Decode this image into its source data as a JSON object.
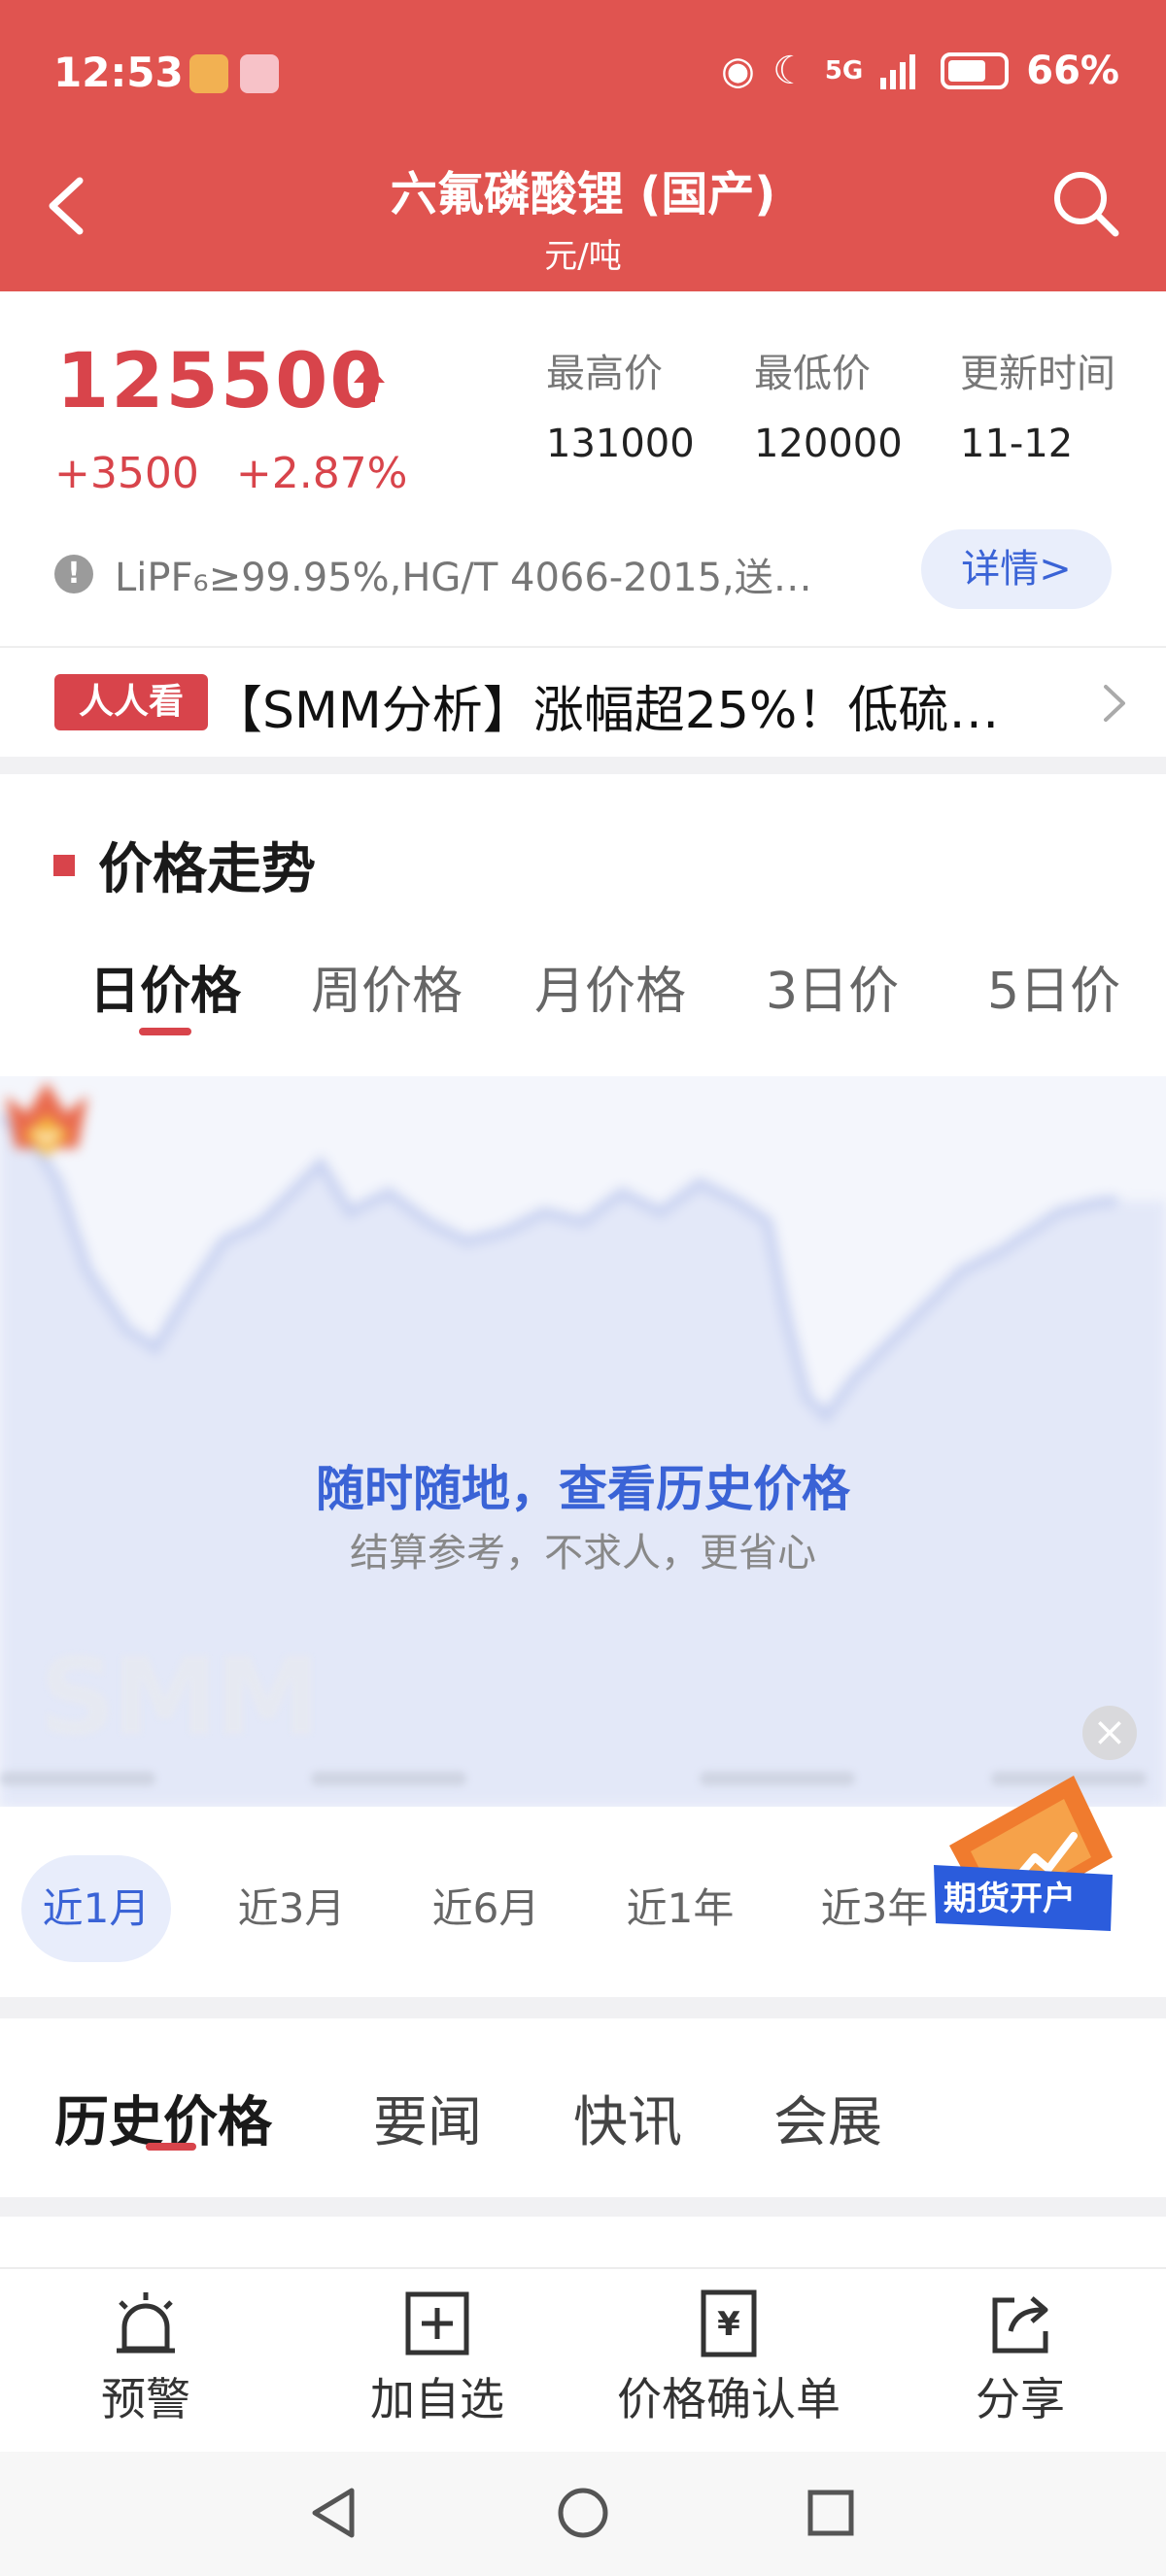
{
  "status_bar": {
    "time": "12:53",
    "network": "5G",
    "battery": "66%"
  },
  "header": {
    "title": "六氟磷酸锂 (国产)",
    "unit": "元/吨"
  },
  "price": {
    "current": "125500",
    "change": "+3500",
    "change_pct": "+2.87%",
    "stats": [
      {
        "label": "最高价",
        "value": "131000"
      },
      {
        "label": "最低价",
        "value": "120000"
      },
      {
        "label": "更新时间",
        "value": "11-12"
      }
    ],
    "spec": "LiPF₆≥99.95%,HG/T 4066-2015,送…",
    "detail_button": "详情>"
  },
  "ticker": {
    "tag": "人人看",
    "text": "【SMM分析】涨幅超25%！低硫…"
  },
  "trend": {
    "title": "价格走势",
    "tabs": [
      "日价格",
      "周价格",
      "月价格",
      "3日价",
      "5日价"
    ],
    "promo_title": "随时随地，查看历史价格",
    "promo_sub": "结算参考，不求人，更省心",
    "ranges": [
      "近1月",
      "近3月",
      "近6月",
      "近1年",
      "近3年"
    ],
    "badge": "期货开户",
    "close_symbol": "×"
  },
  "bottom_tabs": [
    "历史价格",
    "要闻",
    "快讯",
    "会展"
  ],
  "actions": [
    "预警",
    "加自选",
    "价格确认单",
    "分享"
  ],
  "colors": {
    "header": "#e05450",
    "accent_red": "#d8444b",
    "accent_blue": "#3a63d6"
  }
}
